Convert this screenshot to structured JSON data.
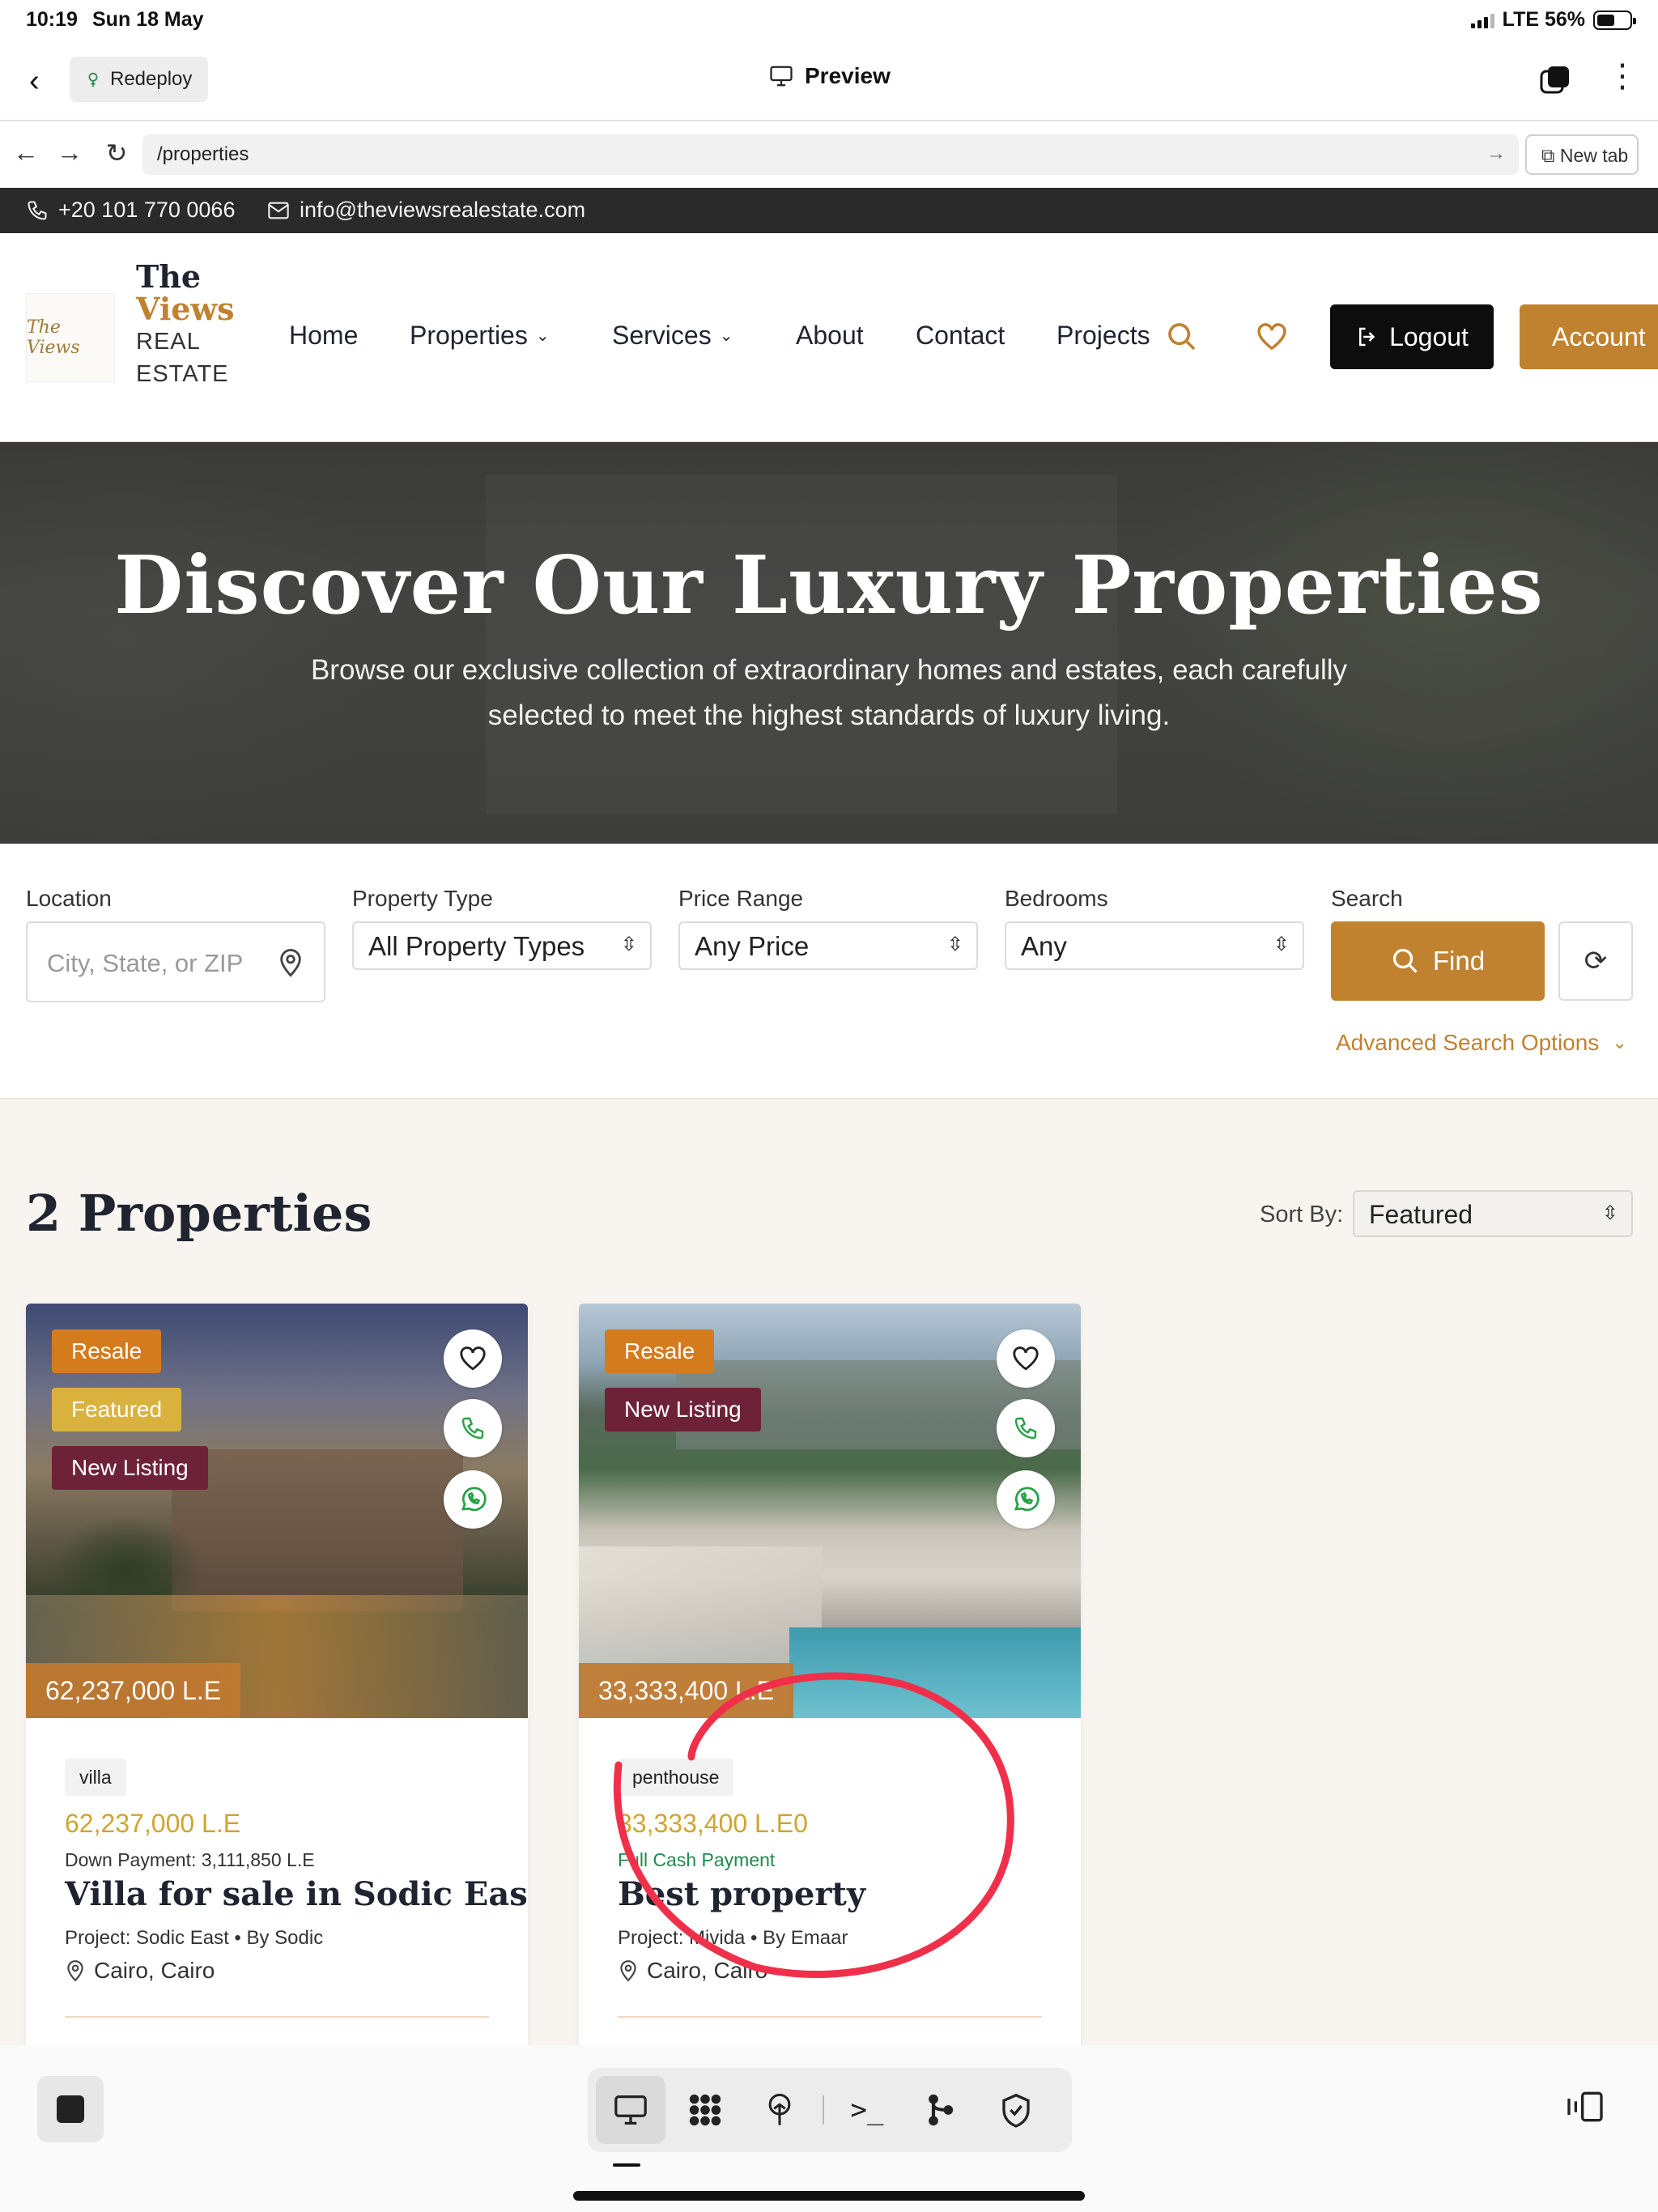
{
  "status": {
    "time": "10:19",
    "date": "Sun 18 May",
    "network": "LTE 56%"
  },
  "appbar": {
    "redeploy_label": "Redeploy",
    "preview_label": "Preview"
  },
  "browser": {
    "url": "/properties",
    "newtab_label": "New tab"
  },
  "topstrip": {
    "phone": "+20 101 770 0066",
    "email": "info@theviewsrealestate.com"
  },
  "brand": {
    "line1": "The",
    "line2": "Views",
    "line3": "REAL",
    "line4": "ESTATE",
    "logo_text": "The Views"
  },
  "nav": {
    "home": "Home",
    "properties": "Properties",
    "services": "Services",
    "about": "About",
    "contact": "Contact",
    "projects": "Projects",
    "logout": "Logout",
    "account": "Account"
  },
  "hero": {
    "title": "Discover Our Luxury Properties",
    "subtitle": "Browse our exclusive collection of extraordinary homes and estates, each carefully selected to meet the highest standards of luxury living."
  },
  "search": {
    "location_label": "Location",
    "location_placeholder": "City, State, or ZIP",
    "type_label": "Property Type",
    "type_value": "All Property Types",
    "price_label": "Price Range",
    "price_value": "Any Price",
    "bedrooms_label": "Bedrooms",
    "bedrooms_value": "Any",
    "search_label": "Search",
    "find_label": "Find",
    "advanced_label": "Advanced Search Options"
  },
  "results": {
    "count_title": "2 Properties",
    "sort_label": "Sort By:",
    "sort_value": "Featured"
  },
  "listings": [
    {
      "badges": [
        "Resale",
        "Featured",
        "New Listing"
      ],
      "price_tag": "62,237,000 L.E",
      "type": "villa",
      "price": "62,237,000 L.E",
      "payment": "Down Payment: 3,111,850 L.E",
      "title": "Villa for sale in Sodic East",
      "project": "Project: Sodic East • By Sodic",
      "location": "Cairo, Cairo"
    },
    {
      "badges": [
        "Resale",
        "New Listing"
      ],
      "price_tag": "33,333,400 L.E",
      "type": "penthouse",
      "price": "33,333,400 L.E0",
      "payment": "Full Cash Payment",
      "title": "Best property",
      "project": "Project: Mivida • By Emaar",
      "location": "Cairo, Cairo"
    }
  ],
  "colors": {
    "accent": "#c0822f",
    "resale": "#d47b1e",
    "featured": "#d9b23e",
    "new_listing": "#6e2238",
    "annotation": "#f0304a"
  },
  "icons": [
    "back-arrow-icon",
    "redeploy-icon",
    "monitor-icon",
    "tabs-icon",
    "more-icon",
    "phone-icon",
    "mail-icon",
    "search-icon",
    "heart-icon",
    "logout-icon",
    "location-pin-icon",
    "reset-icon",
    "chevron-down-icon",
    "whatsapp-icon",
    "terminal-icon",
    "shield-icon",
    "sidebar-icon"
  ]
}
